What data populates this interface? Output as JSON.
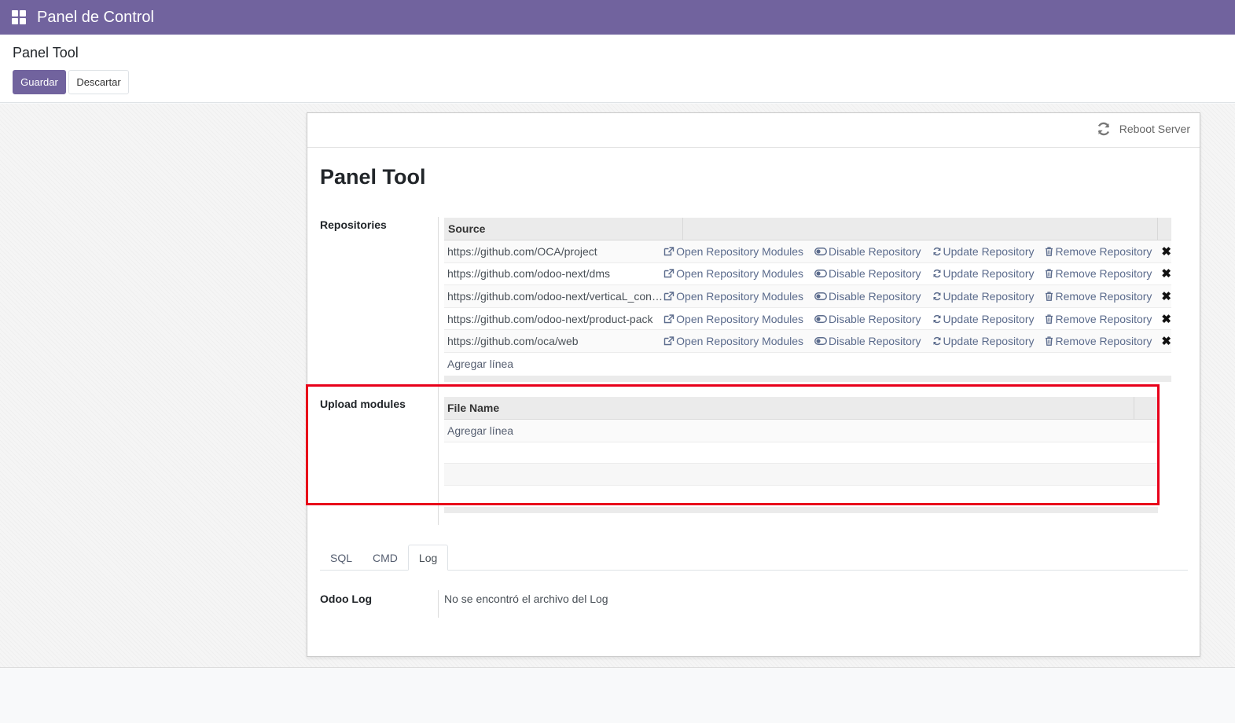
{
  "navbar": {
    "title": "Panel de Control"
  },
  "control_panel": {
    "breadcrumb": "Panel Tool",
    "save_label": "Guardar",
    "discard_label": "Descartar"
  },
  "sheet": {
    "reboot_label": "Reboot Server",
    "title": "Panel Tool",
    "repositories": {
      "label": "Repositories",
      "header_source": "Source",
      "rows": [
        {
          "url": "https://github.com/OCA/project"
        },
        {
          "url": "https://github.com/odoo-next/dms"
        },
        {
          "url": "https://github.com/odoo-next/verticaL_construcci..."
        },
        {
          "url": "https://github.com/odoo-next/product-pack"
        },
        {
          "url": "https://github.com/oca/web"
        }
      ],
      "actions": {
        "open": "Open Repository Modules",
        "disable": "Disable Repository",
        "update": "Update Repository",
        "remove": "Remove Repository"
      },
      "delete_glyph": "✖",
      "add_line": "Agregar línea"
    },
    "upload": {
      "label": "Upload modules",
      "header_file": "File Name",
      "add_line": "Agregar línea"
    },
    "tabs": [
      "SQL",
      "CMD",
      "Log"
    ],
    "active_tab": "Log",
    "log": {
      "label": "Odoo Log",
      "value": "No se encontró el archivo del Log"
    }
  },
  "colors": {
    "brand": "#71639e",
    "highlight": "#e8001a",
    "link": "#5b6b8c"
  }
}
